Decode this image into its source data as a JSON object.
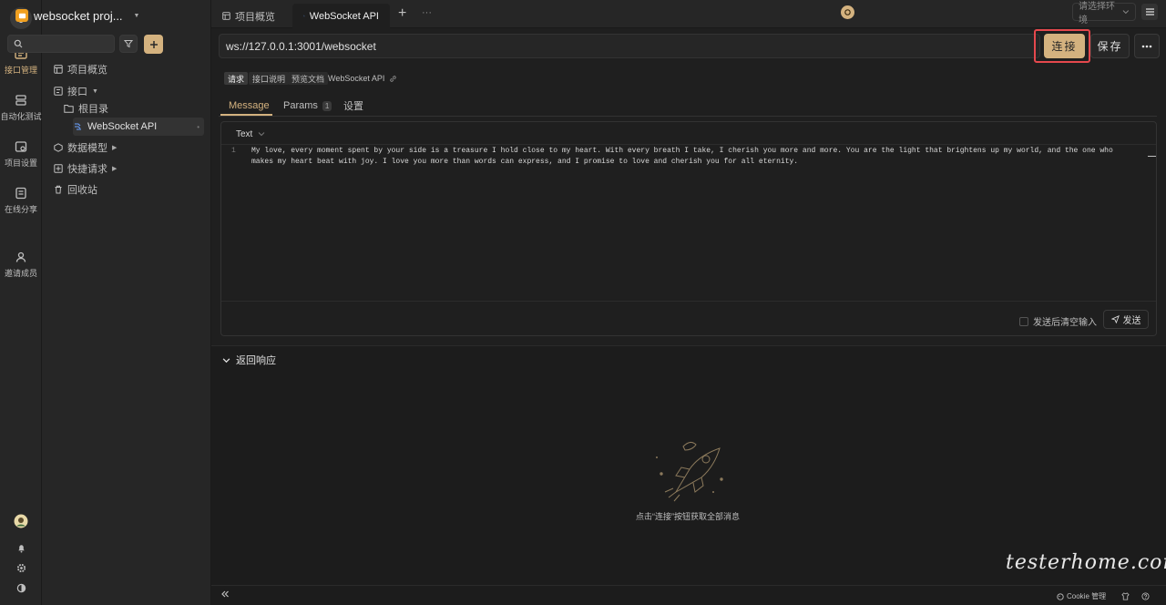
{
  "rail": {
    "items": [
      {
        "label": "接口管理",
        "icon": "api-manage-icon"
      },
      {
        "label": "自动化测试",
        "icon": "automation-icon"
      },
      {
        "label": "项目设置",
        "icon": "project-settings-icon"
      },
      {
        "label": "在线分享",
        "icon": "share-icon"
      },
      {
        "label": "邀请成员",
        "icon": "invite-icon"
      }
    ]
  },
  "sidebar": {
    "project_name": "websocket proj...",
    "tree": {
      "overview": "项目概览",
      "api": "接口",
      "root": "根目录",
      "websocket_api": "WebSocket API",
      "data_model": "数据模型",
      "quick_request": "快捷请求",
      "recycle": "回收站"
    }
  },
  "tabs": {
    "overview": "项目概览",
    "active": "WebSocket API",
    "add": "+",
    "more": "···"
  },
  "env": {
    "placeholder": "请选择环境"
  },
  "request": {
    "url": "ws://127.0.0.1:3001/websocket",
    "connect_label": "连接",
    "save_label": "保存",
    "more_label": "···"
  },
  "subtabs": {
    "request": "请求",
    "desc": "接口说明",
    "preview": "预览文档",
    "title": "WebSocket API"
  },
  "reqtabs": {
    "message": "Message",
    "params": "Params",
    "params_count": "1",
    "settings": "设置"
  },
  "editor": {
    "type": "Text",
    "line_no": "1",
    "content": "My love, every moment spent by your side is a treasure I hold close to my heart. With every breath I take, I cherish you more and more. You are the light that brightens up my world, and the one who makes my heart beat with joy. I love you more than words can express, and I promise to love and cherish you for all eternity.",
    "clear_after_send": "发送后清空输入",
    "send_label": "发送"
  },
  "response": {
    "title": "返回响应",
    "empty_text": "点击“连接”按钮获取全部消息"
  },
  "footer": {
    "watermark": "testerhome.com",
    "cookie": "Cookie 管理"
  },
  "colors": {
    "accent": "#d4b27f",
    "highlight_border": "#e5484d",
    "background": "#1f1f1f"
  }
}
